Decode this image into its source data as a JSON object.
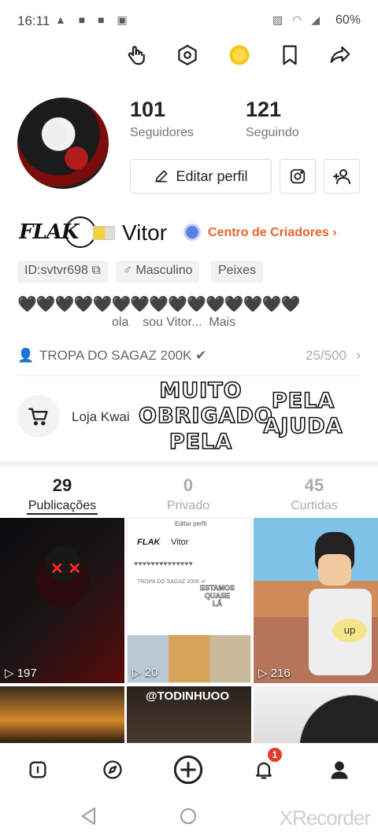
{
  "status": {
    "time": "16:11",
    "left_icons": "▲ ■ ■ ▣",
    "right_icons": "▨ ◠ ◢",
    "battery": "60%"
  },
  "profile": {
    "followers_count": "101",
    "followers_label": "Seguidores",
    "following_count": "121",
    "following_label": "Seguindo",
    "edit_label": "Editar perfil",
    "logo_text": "FLAK",
    "username": "Vitor",
    "creator_center": "Centro de Criadores",
    "id_tag": "ID:svtvr698",
    "gender_tag": "Masculino",
    "sign_tag": "Peixes",
    "hearts": "🖤🖤🖤🖤🖤🖤🖤🖤🖤🖤🖤🖤🖤🖤🖤",
    "bio": "ola    sou Vitor...  Mais",
    "group_name": "TROPA DO SAGAZ 200K ✔",
    "group_count": "25/500",
    "shop_label": "Loja Kwai"
  },
  "overlay": {
    "left_lines": [
      "MUITO",
      "OBRIGADO",
      "PELA"
    ],
    "right_lines": [
      "PELA",
      "AJUDA"
    ]
  },
  "tabs": [
    {
      "count": "29",
      "label": "Publicações"
    },
    {
      "count": "0",
      "label": "Privado"
    },
    {
      "count": "45",
      "label": "Curtidas"
    }
  ],
  "posts": [
    {
      "views": "197"
    },
    {
      "views": "20"
    },
    {
      "views": "216"
    }
  ],
  "thumb_texts": {
    "second_top": "Editar perfil",
    "second_overlay": "ESTAMOS QUASE LÁ",
    "bottom_middle": "@TODINHUOO",
    "up_text": "up"
  },
  "nav": {
    "notification_badge": "1"
  },
  "watermark": "XRecorder",
  "colors": {
    "accent": "#e8622c",
    "badge": "#e63b2e",
    "verified": "#5b7fe0"
  }
}
